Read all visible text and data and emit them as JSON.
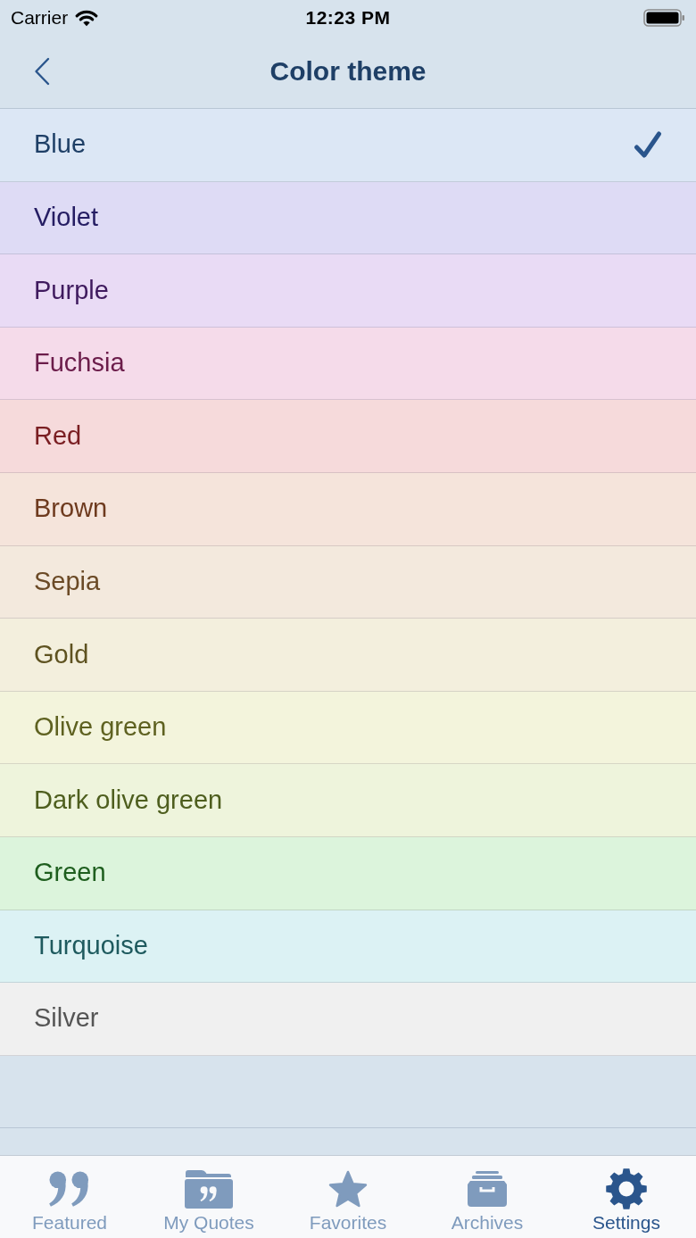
{
  "status_bar": {
    "carrier": "Carrier",
    "time": "12:23 PM"
  },
  "nav_bar": {
    "title": "Color theme"
  },
  "themes": [
    {
      "label": "Blue",
      "selected": true,
      "color": "#1e3f66"
    },
    {
      "label": "Violet",
      "selected": false,
      "color": "#251d63"
    },
    {
      "label": "Purple",
      "selected": false,
      "color": "#3f1a5e"
    },
    {
      "label": "Fuchsia",
      "selected": false,
      "color": "#6b1c4a"
    },
    {
      "label": "Red",
      "selected": false,
      "color": "#7a1e22"
    },
    {
      "label": "Brown",
      "selected": false,
      "color": "#6e3a1e"
    },
    {
      "label": "Sepia",
      "selected": false,
      "color": "#6b4a26"
    },
    {
      "label": "Gold",
      "selected": false,
      "color": "#5e5220"
    },
    {
      "label": "Olive green",
      "selected": false,
      "color": "#5e6120"
    },
    {
      "label": "Dark olive green",
      "selected": false,
      "color": "#4e5e1e"
    },
    {
      "label": "Green",
      "selected": false,
      "color": "#1e5e1e"
    },
    {
      "label": "Turquoise",
      "selected": false,
      "color": "#1e5a5e"
    },
    {
      "label": "Silver",
      "selected": false,
      "color": "#555555"
    }
  ],
  "tab_bar": [
    {
      "label": "Featured",
      "selected": false
    },
    {
      "label": "My Quotes",
      "selected": false
    },
    {
      "label": "Favorites",
      "selected": false
    },
    {
      "label": "Archives",
      "selected": false
    },
    {
      "label": "Settings",
      "selected": true
    }
  ]
}
